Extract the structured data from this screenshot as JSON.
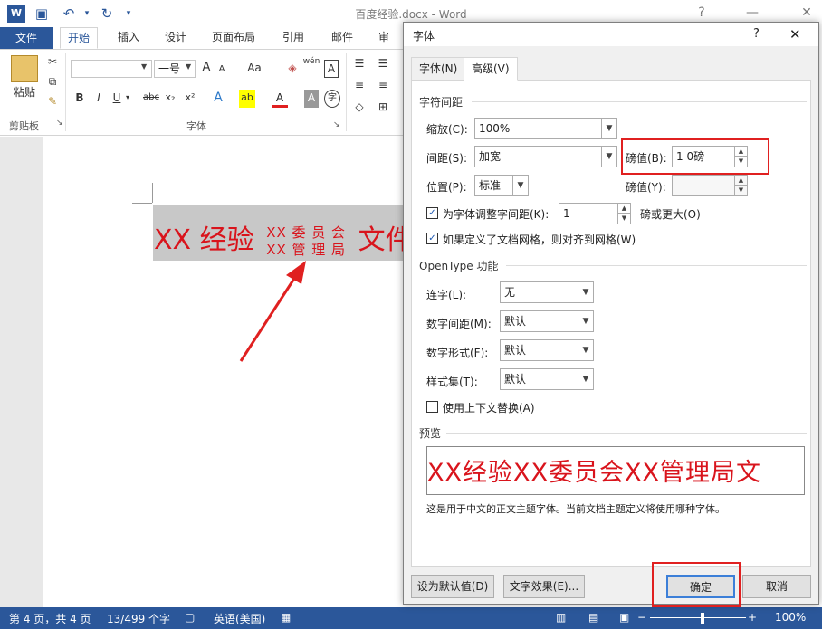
{
  "titlebar": {
    "title": "百度经验.docx - Word",
    "help": "?",
    "minimize": "—",
    "close": "✕"
  },
  "ribbon": {
    "tabs": [
      "文件",
      "开始",
      "插入",
      "设计",
      "页面布局",
      "引用",
      "邮件",
      "审阅"
    ],
    "clipboard": {
      "paste_label": "粘贴",
      "group_label": "剪贴板"
    },
    "font": {
      "font_name": "",
      "font_size": "一号",
      "group_label": "字体",
      "grow": "A",
      "shrink": "A",
      "case": "Aa",
      "bold": "B",
      "italic": "I",
      "underline": "U",
      "strike": "abc",
      "sub": "x₂",
      "sup": "x²",
      "pinyin": "wén",
      "border_char": "A",
      "shade_char": "A",
      "circle_char": "字"
    }
  },
  "document": {
    "text_main": "XX 经验",
    "stack_top": "XX 委 员 会",
    "stack_bottom": "XX 管 理 局",
    "text_tail": "文件"
  },
  "statusbar": {
    "page": "第 4 页，共 4 页",
    "words": "13/499 个字",
    "language": "英语(美国)",
    "zoom": "100%"
  },
  "dialog": {
    "title": "字体",
    "help": "?",
    "close": "✕",
    "tabs": [
      "字体(N)",
      "高级(V)"
    ],
    "spacing_section": "字符间距",
    "scale_label": "缩放(C):",
    "scale_value": "100%",
    "spacing_label": "间距(S):",
    "spacing_value": "加宽",
    "spacing_by_label": "磅值(B):",
    "spacing_by_value": "1 0磅",
    "position_label": "位置(P):",
    "position_value": "标准",
    "position_by_label": "磅值(Y):",
    "position_by_value": "",
    "kerning_label": "为字体调整字间距(K):",
    "kerning_value": "1",
    "kerning_suffix": "磅或更大(O)",
    "grid_label": "如果定义了文档网格，则对齐到网格(W)",
    "opentype_section": "OpenType 功能",
    "ligatures_label": "连字(L):",
    "ligatures_value": "无",
    "num_spacing_label": "数字间距(M):",
    "num_spacing_value": "默认",
    "num_forms_label": "数字形式(F):",
    "num_forms_value": "默认",
    "stylistic_label": "样式集(T):",
    "stylistic_value": "默认",
    "contextual_label": "使用上下文替换(A)",
    "preview_section": "预览",
    "preview_text": "XX经验XX委员会XX管理局文",
    "preview_note": "这是用于中文的正文主题字体。当前文档主题定义将使用哪种字体。",
    "set_default": "设为默认值(D)",
    "text_effects": "文字效果(E)...",
    "ok": "确定",
    "cancel": "取消"
  },
  "colors": {
    "accent": "#2b579a",
    "doc_text": "#d9141c",
    "highlight": "#e02020"
  }
}
